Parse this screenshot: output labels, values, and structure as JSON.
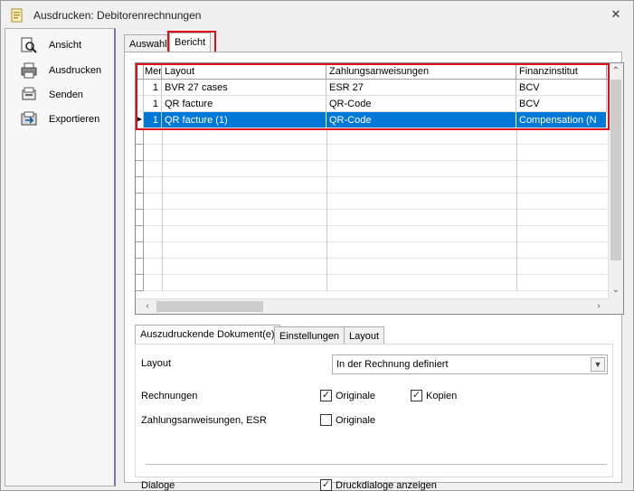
{
  "window": {
    "title": "Ausdrucken: Debitorenrechnungen",
    "close_glyph": "✕"
  },
  "nav": {
    "items": [
      {
        "label": "Ansicht",
        "icon": "magnifier-page-icon"
      },
      {
        "label": "Ausdrucken",
        "icon": "printer-icon"
      },
      {
        "label": "Senden",
        "icon": "send-icon"
      },
      {
        "label": "Exportieren",
        "icon": "export-icon"
      }
    ]
  },
  "tabs": [
    {
      "label": "Auswahl"
    },
    {
      "label": "Bericht"
    }
  ],
  "grid": {
    "columns": [
      "Men",
      "Layout",
      "Zahlungsanweisungen",
      "Finanzinstitut"
    ],
    "rows": [
      {
        "men": "1",
        "layout": "BVR 27 cases",
        "zahlung": "ESR 27",
        "finanz": "BCV",
        "selected": false
      },
      {
        "men": "1",
        "layout": "QR facture",
        "zahlung": "QR-Code",
        "finanz": "BCV",
        "selected": false
      },
      {
        "men": "1",
        "layout": "QR facture (1)",
        "zahlung": "QR-Code",
        "finanz": "Compensation (N",
        "selected": true
      }
    ],
    "row_indicator": "▶"
  },
  "subtabs": [
    {
      "label": "Auszudruckende Dokument(e)"
    },
    {
      "label": "Einstellungen"
    },
    {
      "label": "Layout"
    }
  ],
  "form": {
    "layout_label": "Layout",
    "layout_value": "In der Rechnung definiert",
    "rechnungen_label": "Rechnungen",
    "originale_label": "Originale",
    "kopien_label": "Kopien",
    "zahlung_label": "Zahlungsanweisungen, ESR",
    "zahlung_originale_label": "Originale",
    "dialoge_label": "Dialoge",
    "druckdialoge_label": "Druckdialoge anzeigen"
  },
  "colors": {
    "selection": "#0078d7",
    "highlight": "#e0101a"
  }
}
